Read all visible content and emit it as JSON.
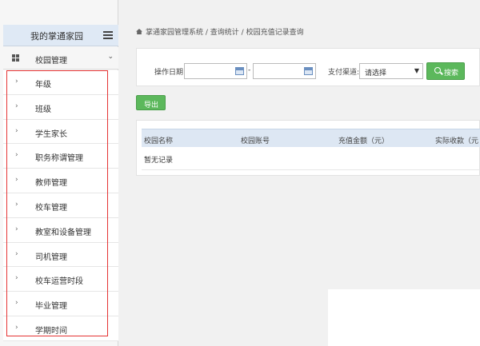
{
  "sidebar": {
    "brand_title": "我的掌通家园",
    "menu_header": "校园管理",
    "items": [
      {
        "label": "年级"
      },
      {
        "label": "班级"
      },
      {
        "label": "学生家长"
      },
      {
        "label": "职务称谓管理"
      },
      {
        "label": "教师管理"
      },
      {
        "label": "校车管理"
      },
      {
        "label": "教室和设备管理"
      },
      {
        "label": "司机管理"
      },
      {
        "label": "校车运营时段"
      },
      {
        "label": "毕业管理"
      },
      {
        "label": "学期时间"
      }
    ]
  },
  "breadcrumb": {
    "part1": "掌通家园管理系统",
    "sep": " / ",
    "part2": "查询统计",
    "part3": "校园充值记录查询"
  },
  "filters": {
    "date_label": "操作日期:",
    "date_from": "",
    "date_to": "",
    "date_sep": "-",
    "channel_label": "支付渠道:",
    "channel_value": "请选择",
    "search_label": "搜索"
  },
  "toolbar": {
    "export_label": "导出"
  },
  "table": {
    "columns": [
      "校园名称",
      "校园账号",
      "充值金额（元）",
      "实际收款（元"
    ],
    "empty_text": "暂无记录"
  },
  "colors": {
    "accent_green": "#5cb85c",
    "header_blue": "#dde7f3",
    "highlight_red": "#e53333"
  }
}
